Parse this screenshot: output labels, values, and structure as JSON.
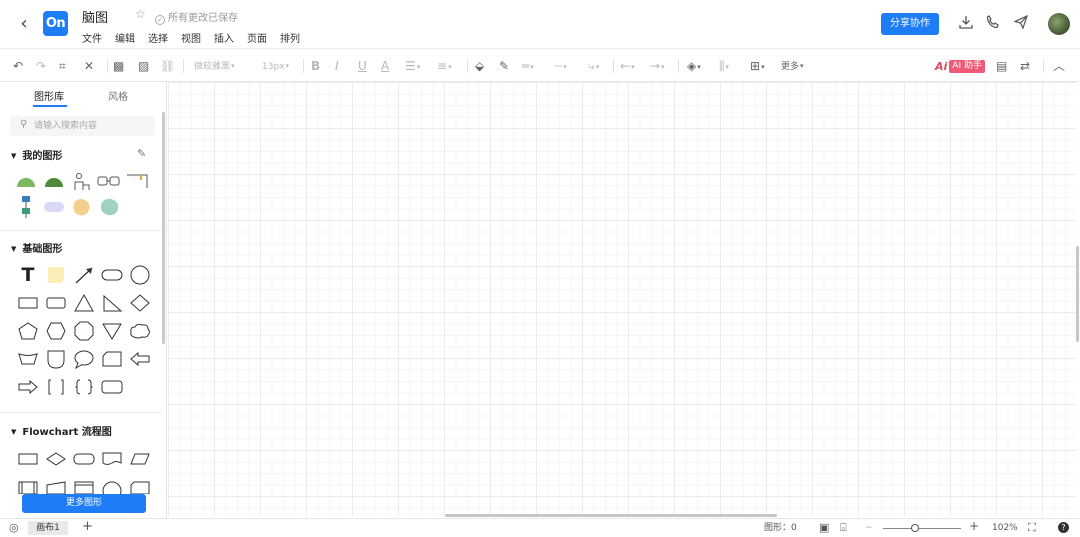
{
  "header": {
    "back_icon": "chevron-left-icon",
    "logo_text": "On",
    "doc_title": "脑图",
    "save_status": "所有更改已保存",
    "menu": [
      "文件",
      "编辑",
      "选择",
      "视图",
      "插入",
      "页面",
      "排列"
    ],
    "share_label": "分享协作"
  },
  "toolbar": {
    "font_family": "微软雅黑",
    "font_size": "13px",
    "more_label": "更多",
    "ai_mark": "Ai",
    "ai_label": "AI 助手"
  },
  "sidebar": {
    "tabs": [
      "图形库",
      "风格"
    ],
    "search_placeholder": "请输入搜索内容",
    "sections": [
      {
        "label": "我的图形"
      },
      {
        "label": "基础图形"
      },
      {
        "label": "Flowchart 流程图"
      }
    ],
    "basic_text_shape": "T",
    "more_shapes_label": "更多图形"
  },
  "statusbar": {
    "page_label": "画布1",
    "add_icon": "+",
    "shape_count_label": "图形：0",
    "zoom_minus": "−",
    "zoom_plus": "+",
    "zoom_level": "102%",
    "zoom_fraction": 0.41
  },
  "colors": {
    "accent": "#1f7cf7",
    "ai": "#ef5b77",
    "shape_green_light": "#7bb85f",
    "shape_green_dark": "#4e8a3a",
    "shape_lavender": "#d9d9f5",
    "shape_orange": "#f5cf8e",
    "shape_teal": "#9fd3c0"
  }
}
